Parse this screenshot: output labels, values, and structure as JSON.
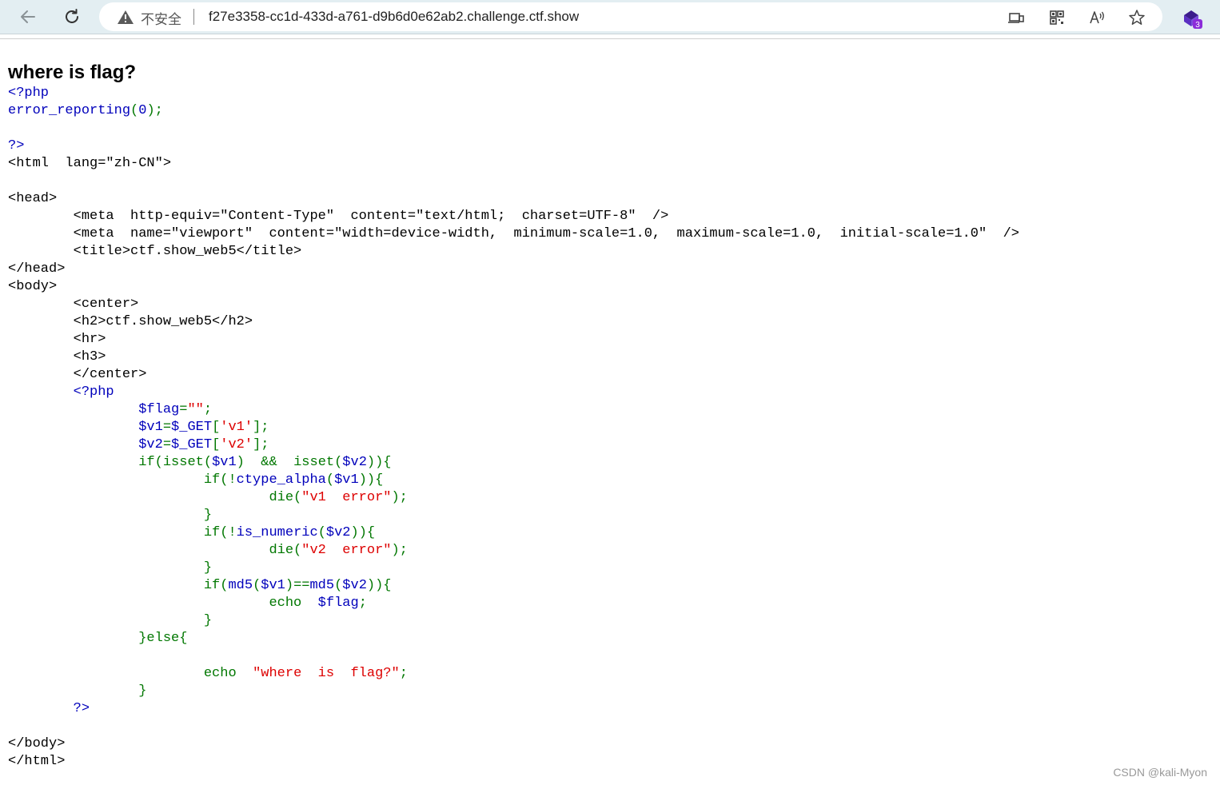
{
  "browser": {
    "security_label": "不安全",
    "url": "f27e3358-cc1d-433d-a761-d9b6d0e62ab2.challenge.ctf.show",
    "extension_badge": "3",
    "icons": {
      "back": "back-arrow-icon",
      "reload": "reload-icon",
      "warning": "warning-icon",
      "app_available": "app-available-icon",
      "qr": "qr-code-icon",
      "read_aloud": "read-aloud-icon",
      "favorite": "star-icon",
      "extension": "extension-icon"
    }
  },
  "page": {
    "heading": "where is flag?",
    "code_lines": [
      [
        {
          "c": "php",
          "t": "<?php"
        }
      ],
      [
        {
          "c": "v",
          "t": "error_reporting"
        },
        {
          "c": "k",
          "t": "("
        },
        {
          "c": "v",
          "t": "0"
        },
        {
          "c": "k",
          "t": ");"
        }
      ],
      [],
      [
        {
          "c": "php",
          "t": "?>"
        }
      ],
      [
        {
          "c": "tag",
          "t": "<html  lang=\"zh-CN\">"
        }
      ],
      [],
      [
        {
          "c": "tag",
          "t": "<head>"
        }
      ],
      [
        {
          "c": "tag",
          "t": "        <meta  http-equiv=\"Content-Type\"  content=\"text/html;  charset=UTF-8\"  />"
        }
      ],
      [
        {
          "c": "tag",
          "t": "        <meta  name=\"viewport\"  content=\"width=device-width,  minimum-scale=1.0,  maximum-scale=1.0,  initial-scale=1.0\"  />"
        }
      ],
      [
        {
          "c": "tag",
          "t": "        <title>ctf.show_web5</title>"
        }
      ],
      [
        {
          "c": "tag",
          "t": "</head>"
        }
      ],
      [
        {
          "c": "tag",
          "t": "<body>"
        }
      ],
      [
        {
          "c": "tag",
          "t": "        <center>"
        }
      ],
      [
        {
          "c": "tag",
          "t": "        <h2>ctf.show_web5</h2>"
        }
      ],
      [
        {
          "c": "tag",
          "t": "        <hr>"
        }
      ],
      [
        {
          "c": "tag",
          "t": "        <h3>"
        }
      ],
      [
        {
          "c": "tag",
          "t": "        </center>"
        }
      ],
      [
        {
          "c": "tag",
          "t": "        "
        },
        {
          "c": "php",
          "t": "<?php"
        }
      ],
      [
        {
          "c": "tag",
          "t": "                "
        },
        {
          "c": "v",
          "t": "$flag"
        },
        {
          "c": "k",
          "t": "="
        },
        {
          "c": "s",
          "t": "\"\""
        },
        {
          "c": "k",
          "t": ";"
        }
      ],
      [
        {
          "c": "tag",
          "t": "                "
        },
        {
          "c": "v",
          "t": "$v1"
        },
        {
          "c": "k",
          "t": "="
        },
        {
          "c": "v",
          "t": "$_GET"
        },
        {
          "c": "k",
          "t": "["
        },
        {
          "c": "s",
          "t": "'v1'"
        },
        {
          "c": "k",
          "t": "];"
        }
      ],
      [
        {
          "c": "tag",
          "t": "                "
        },
        {
          "c": "v",
          "t": "$v2"
        },
        {
          "c": "k",
          "t": "="
        },
        {
          "c": "v",
          "t": "$_GET"
        },
        {
          "c": "k",
          "t": "["
        },
        {
          "c": "s",
          "t": "'v2'"
        },
        {
          "c": "k",
          "t": "];"
        }
      ],
      [
        {
          "c": "tag",
          "t": "                "
        },
        {
          "c": "k",
          "t": "if(isset("
        },
        {
          "c": "v",
          "t": "$v1"
        },
        {
          "c": "k",
          "t": ")  &&  isset("
        },
        {
          "c": "v",
          "t": "$v2"
        },
        {
          "c": "k",
          "t": ")){"
        }
      ],
      [
        {
          "c": "tag",
          "t": "                        "
        },
        {
          "c": "k",
          "t": "if(!"
        },
        {
          "c": "v",
          "t": "ctype_alpha"
        },
        {
          "c": "k",
          "t": "("
        },
        {
          "c": "v",
          "t": "$v1"
        },
        {
          "c": "k",
          "t": ")){"
        }
      ],
      [
        {
          "c": "tag",
          "t": "                                "
        },
        {
          "c": "k",
          "t": "die("
        },
        {
          "c": "s",
          "t": "\"v1  error\""
        },
        {
          "c": "k",
          "t": ");"
        }
      ],
      [
        {
          "c": "tag",
          "t": "                        "
        },
        {
          "c": "k",
          "t": "}"
        }
      ],
      [
        {
          "c": "tag",
          "t": "                        "
        },
        {
          "c": "k",
          "t": "if(!"
        },
        {
          "c": "v",
          "t": "is_numeric"
        },
        {
          "c": "k",
          "t": "("
        },
        {
          "c": "v",
          "t": "$v2"
        },
        {
          "c": "k",
          "t": ")){"
        }
      ],
      [
        {
          "c": "tag",
          "t": "                                "
        },
        {
          "c": "k",
          "t": "die("
        },
        {
          "c": "s",
          "t": "\"v2  error\""
        },
        {
          "c": "k",
          "t": ");"
        }
      ],
      [
        {
          "c": "tag",
          "t": "                        "
        },
        {
          "c": "k",
          "t": "}"
        }
      ],
      [
        {
          "c": "tag",
          "t": "                        "
        },
        {
          "c": "k",
          "t": "if("
        },
        {
          "c": "v",
          "t": "md5"
        },
        {
          "c": "k",
          "t": "("
        },
        {
          "c": "v",
          "t": "$v1"
        },
        {
          "c": "k",
          "t": ")=="
        },
        {
          "c": "v",
          "t": "md5"
        },
        {
          "c": "k",
          "t": "("
        },
        {
          "c": "v",
          "t": "$v2"
        },
        {
          "c": "k",
          "t": ")){"
        }
      ],
      [
        {
          "c": "tag",
          "t": "                                "
        },
        {
          "c": "k",
          "t": "echo  "
        },
        {
          "c": "v",
          "t": "$flag"
        },
        {
          "c": "k",
          "t": ";"
        }
      ],
      [
        {
          "c": "tag",
          "t": "                        "
        },
        {
          "c": "k",
          "t": "}"
        }
      ],
      [
        {
          "c": "tag",
          "t": "                "
        },
        {
          "c": "k",
          "t": "}else{"
        }
      ],
      [],
      [
        {
          "c": "tag",
          "t": "                        "
        },
        {
          "c": "k",
          "t": "echo  "
        },
        {
          "c": "s",
          "t": "\"where  is  flag?\""
        },
        {
          "c": "k",
          "t": ";"
        }
      ],
      [
        {
          "c": "tag",
          "t": "                "
        },
        {
          "c": "k",
          "t": "}"
        }
      ],
      [
        {
          "c": "tag",
          "t": "        "
        },
        {
          "c": "php",
          "t": "?>"
        }
      ],
      [],
      [
        {
          "c": "tag",
          "t": "</body>"
        }
      ],
      [
        {
          "c": "tag",
          "t": "</html>"
        }
      ]
    ]
  },
  "watermark": "CSDN @kali-Myon"
}
